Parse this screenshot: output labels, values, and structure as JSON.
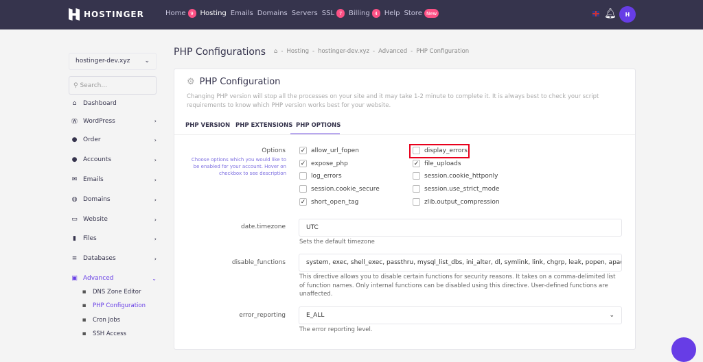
{
  "header": {
    "brand": "HOSTINGER",
    "nav": [
      {
        "label": "Home",
        "badge": "9"
      },
      {
        "label": "Hosting",
        "badge": null
      },
      {
        "label": "Emails",
        "badge": null
      },
      {
        "label": "Domains",
        "badge": null
      },
      {
        "label": "Servers",
        "badge": null
      },
      {
        "label": "SSL",
        "badge": "7"
      },
      {
        "label": "Billing",
        "badge": "4"
      },
      {
        "label": "Help",
        "badge": null
      },
      {
        "label": "Store",
        "badge": "New"
      }
    ],
    "avatar": "H"
  },
  "sidebar": {
    "domain": "hostinger-dev.xyz",
    "search_placeholder": "Search...",
    "items": [
      {
        "label": "Dashboard",
        "icon": "⌂"
      },
      {
        "label": "WordPress",
        "icon": "Ⓦ"
      },
      {
        "label": "Order",
        "icon": "●"
      },
      {
        "label": "Accounts",
        "icon": "●"
      },
      {
        "label": "Emails",
        "icon": "✉"
      },
      {
        "label": "Domains",
        "icon": "◍"
      },
      {
        "label": "Website",
        "icon": "▭"
      },
      {
        "label": "Files",
        "icon": "▮"
      },
      {
        "label": "Databases",
        "icon": "≡"
      },
      {
        "label": "Advanced",
        "icon": "▣"
      }
    ],
    "sub_items": [
      "DNS Zone Editor",
      "PHP Configuration",
      "Cron Jobs",
      "SSH Access"
    ]
  },
  "page": {
    "title": "PHP Configurations",
    "breadcrumb": [
      "Hosting",
      "hostinger-dev.xyz",
      "Advanced",
      "PHP Configuration"
    ]
  },
  "card": {
    "title": "PHP Configuration",
    "description": "Changing PHP version will stop all the processes on your site and it may take 1-2 minute to complete it. It is always best to check your script requirements to know which PHP version works best for your website.",
    "tabs": [
      "PHP VERSION",
      "PHP EXTENSIONS",
      "PHP OPTIONS"
    ],
    "active_tab": "PHP OPTIONS"
  },
  "options": {
    "label": "Options",
    "hint": "Choose options which you would like to be enabled for your account. Hover on checkbox to see description",
    "col1": [
      {
        "name": "allow_url_fopen",
        "checked": true
      },
      {
        "name": "expose_php",
        "checked": true
      },
      {
        "name": "log_errors",
        "checked": false
      },
      {
        "name": "session.cookie_secure",
        "checked": false
      },
      {
        "name": "short_open_tag",
        "checked": true
      }
    ],
    "col2": [
      {
        "name": "display_errors",
        "checked": false
      },
      {
        "name": "file_uploads",
        "checked": true
      },
      {
        "name": "session.cookie_httponly",
        "checked": false
      },
      {
        "name": "session.use_strict_mode",
        "checked": false
      },
      {
        "name": "zlib.output_compression",
        "checked": false
      }
    ]
  },
  "fields": {
    "timezone": {
      "label": "date.timezone",
      "value": "UTC",
      "help": "Sets the default timezone"
    },
    "disable_functions": {
      "label": "disable_functions",
      "value": "system, exec, shell_exec, passthru, mysql_list_dbs, ini_alter, dl, symlink, link, chgrp, leak, popen, apache_chi",
      "help": "This directive allows you to disable certain functions for security reasons. It takes on a comma-delimited list of function names. Only internal functions can be disabled using this directive. User-defined functions are unaffected."
    },
    "error_reporting": {
      "label": "error_reporting",
      "value": "E_ALL",
      "help": "The error reporting level."
    }
  }
}
